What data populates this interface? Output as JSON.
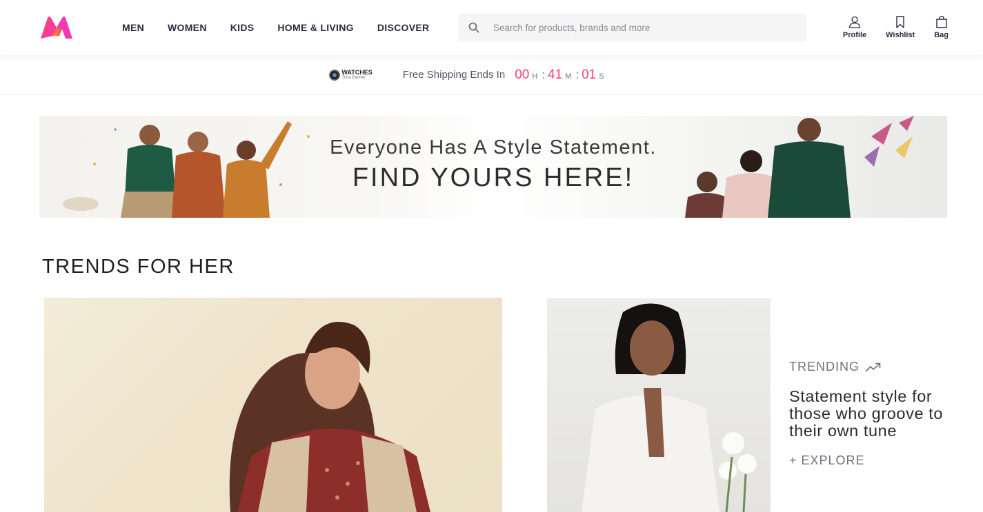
{
  "brand": {
    "name": "Myntra",
    "accent": "#ff3f6c"
  },
  "nav": {
    "items": [
      {
        "label": "MEN"
      },
      {
        "label": "WOMEN"
      },
      {
        "label": "KIDS"
      },
      {
        "label": "HOME & LIVING"
      },
      {
        "label": "DISCOVER"
      }
    ]
  },
  "search": {
    "placeholder": "Search for products, brands and more",
    "value": "",
    "icon": "search-icon"
  },
  "actions": {
    "profile": {
      "label": "Profile",
      "icon": "user-icon"
    },
    "wishlist": {
      "label": "Wishlist",
      "icon": "bookmark-icon"
    },
    "bag": {
      "label": "Bag",
      "icon": "bag-icon"
    }
  },
  "promo_strip": {
    "partner_name": "WATCHES",
    "partner_sub": "Time Partner",
    "message": "Free Shipping Ends In",
    "timer": {
      "hours": "00",
      "hours_unit": "H",
      "minutes": "41",
      "minutes_unit": "M",
      "seconds": "01",
      "seconds_unit": "S"
    }
  },
  "hero_banner": {
    "line1": "Everyone Has A Style Statement.",
    "line2": "FIND YOURS HERE!"
  },
  "trends_section": {
    "title": "TRENDS FOR HER",
    "trending_label": "TRENDING",
    "headline": "Statement style for those who groove to their own tune",
    "explore_label": "+ EXPLORE"
  }
}
